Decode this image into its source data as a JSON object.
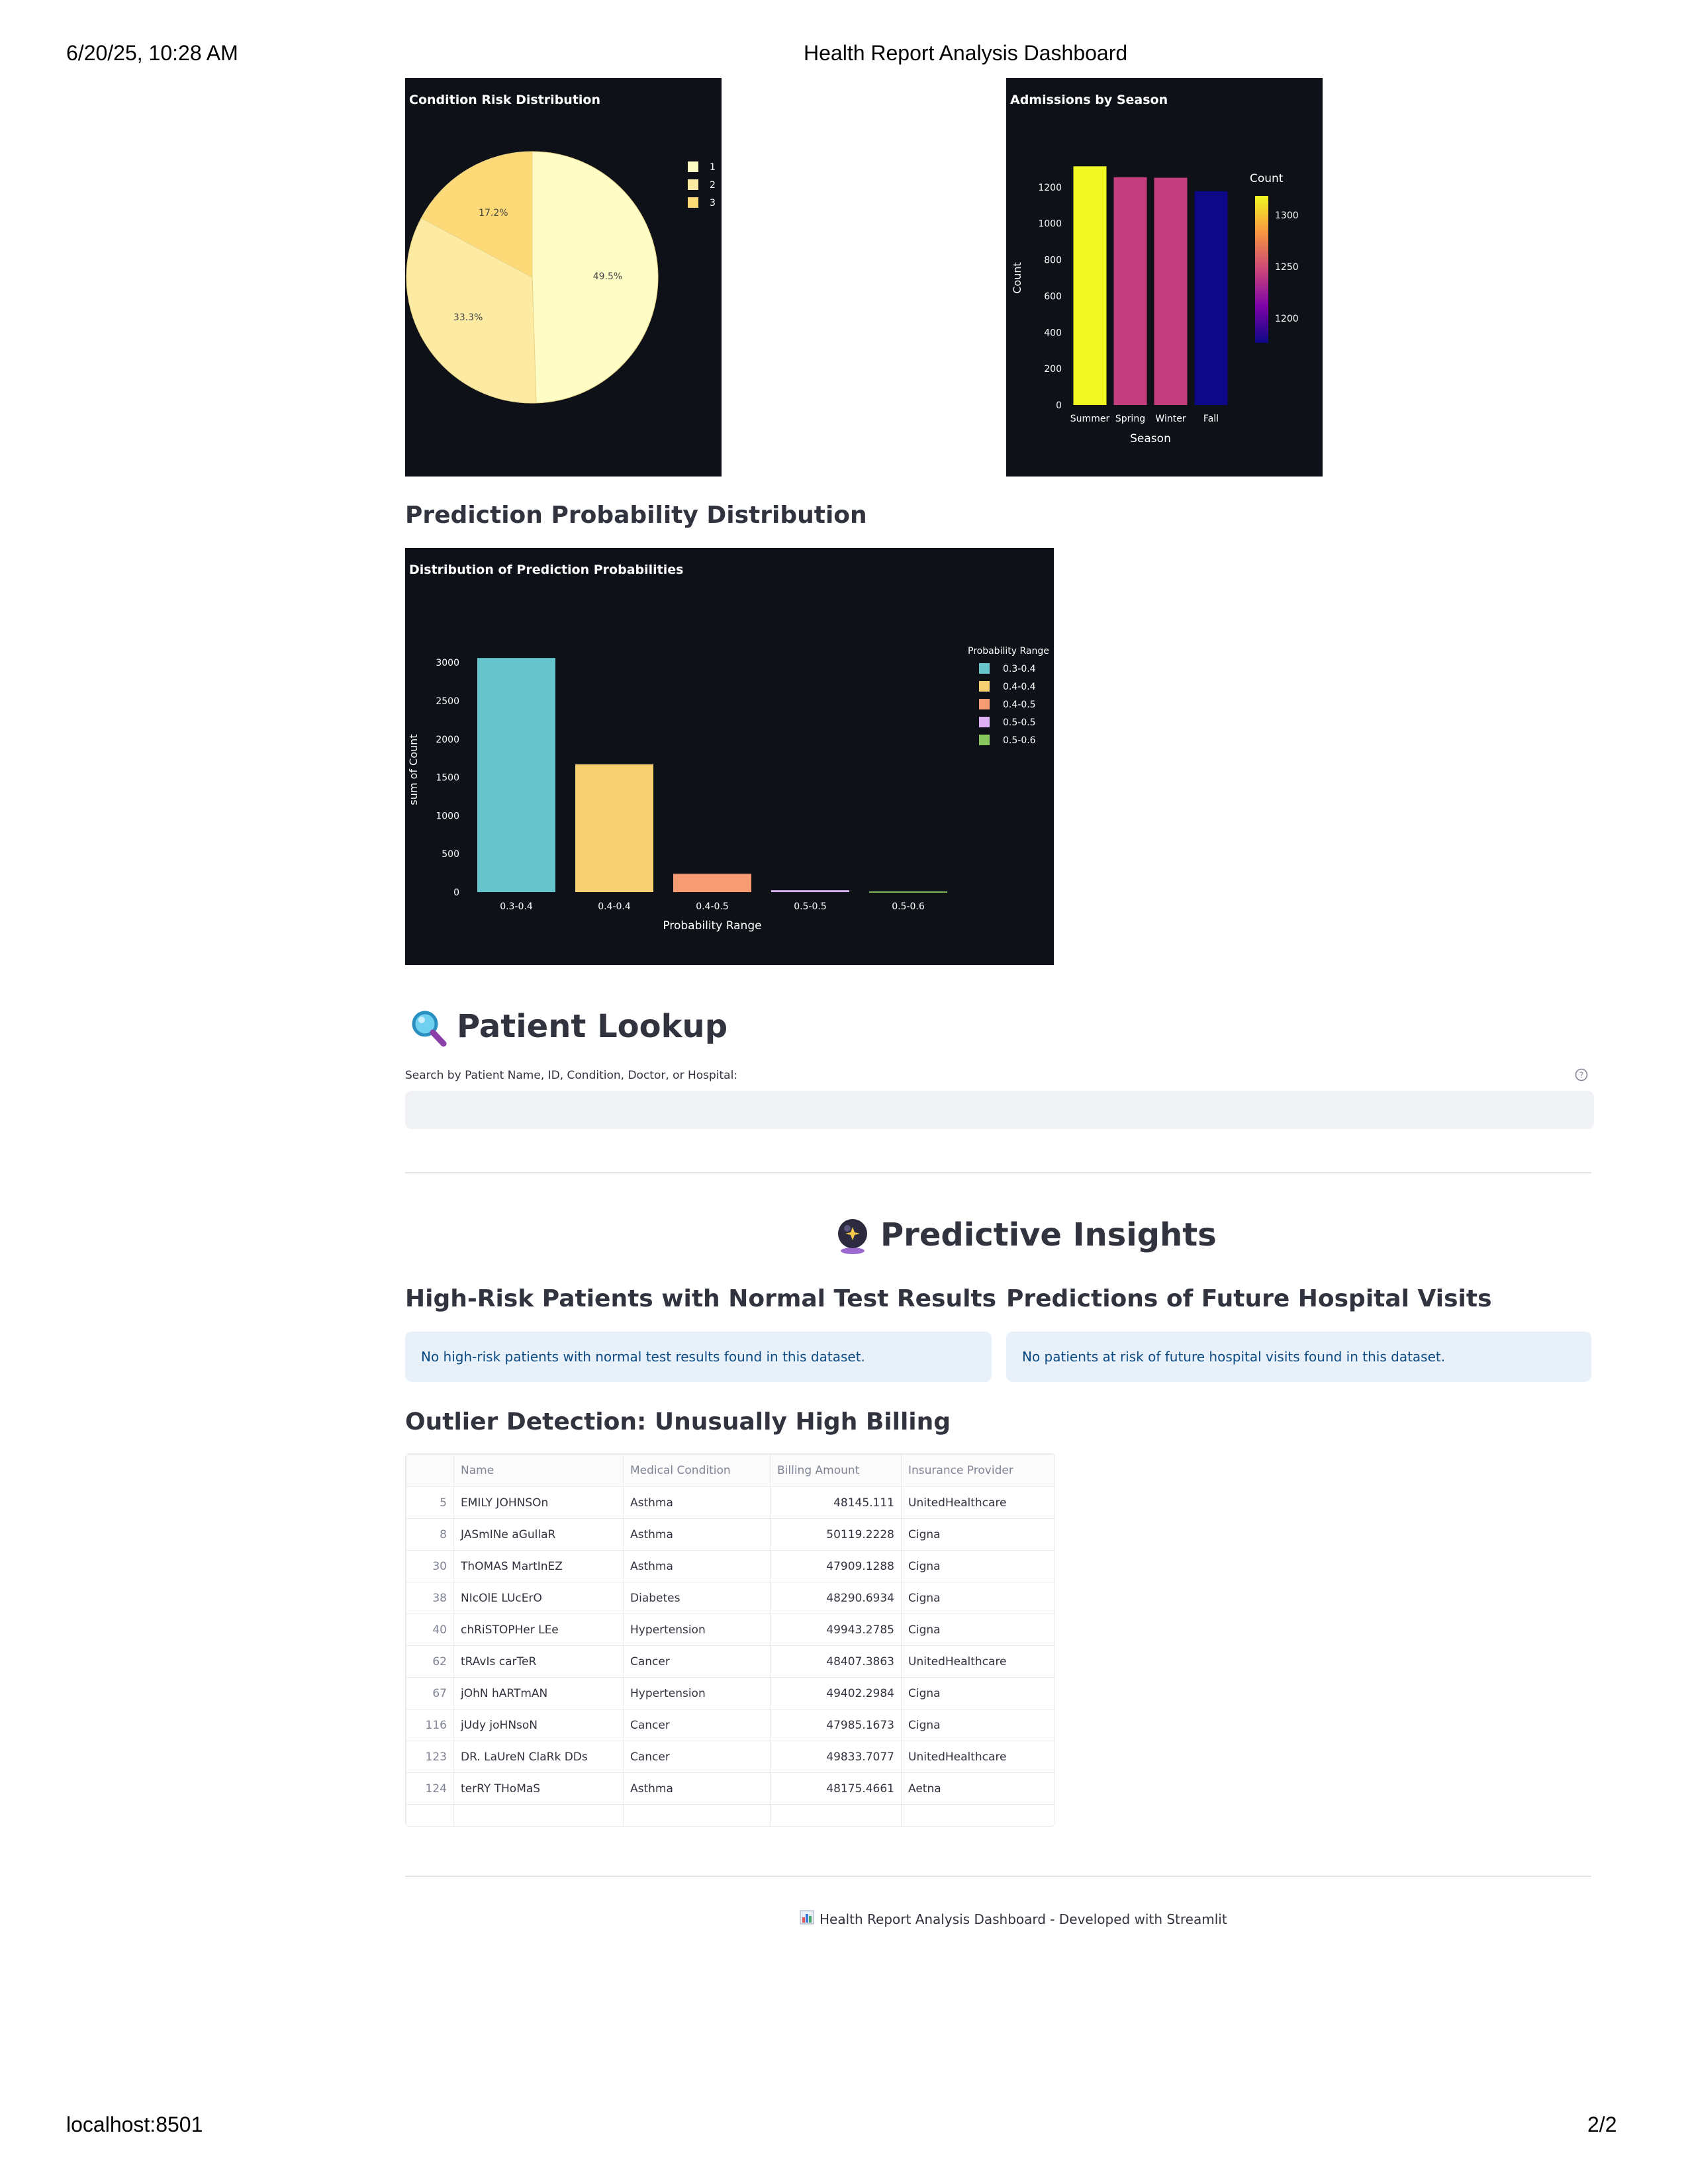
{
  "print_header": {
    "datetime": "6/20/25, 10:28 AM",
    "title": "Health Report Analysis Dashboard"
  },
  "print_footer": {
    "url": "localhost:8501",
    "page": "2/2"
  },
  "charts": {
    "risk_title": "Condition Risk Distribution",
    "season_title": "Admissions by Season",
    "prob_section_title": "Prediction Probability Distribution",
    "prob_title": "Distribution of Prediction Probabilities"
  },
  "chart_data": [
    {
      "type": "pie",
      "title": "Condition Risk Distribution",
      "labels": [
        "1",
        "2",
        "3"
      ],
      "values": [
        49.5,
        33.3,
        17.2
      ],
      "value_labels": [
        "49.5%",
        "33.3%",
        "17.2%"
      ],
      "colors": [
        "#fefdc6",
        "#feeba3",
        "#fed977"
      ],
      "legend": "top-right"
    },
    {
      "type": "bar",
      "title": "Admissions by Season",
      "categories": [
        "Summer",
        "Spring",
        "Winter",
        "Fall"
      ],
      "values": [
        1315,
        1255,
        1252,
        1178
      ],
      "xlabel": "Season",
      "ylabel": "Count",
      "ylim": [
        0,
        1400
      ],
      "yticks": [
        0,
        200,
        400,
        600,
        800,
        1000,
        1200
      ],
      "colors": [
        "#f0f921",
        "#c43e7e",
        "#c43e7e",
        "#0d0887"
      ],
      "colorbar": {
        "title": "Count",
        "ticks": [
          "1300",
          "1250",
          "1200"
        ],
        "placement": "right"
      }
    },
    {
      "type": "bar",
      "title": "Distribution of Prediction Probabilities",
      "categories": [
        "0.3-0.4",
        "0.4-0.4",
        "0.4-0.5",
        "0.5-0.5",
        "0.5-0.6"
      ],
      "values": [
        3060,
        1670,
        240,
        25,
        10
      ],
      "xlabel": "Probability Range",
      "ylabel": "sum of Count",
      "ylim": [
        0,
        3200
      ],
      "yticks": [
        0,
        500,
        1000,
        1500,
        2000,
        2500,
        3000
      ],
      "colors": [
        "#66c5cc",
        "#f6cf71",
        "#f89c74",
        "#dcb0f2",
        "#87c55f"
      ],
      "legend_title": "Probability Range",
      "legend": "top-right"
    }
  ],
  "patient_lookup": {
    "icon": "magnifier-icon",
    "title": "Patient Lookup",
    "search_label": "Search by Patient Name, ID, Condition, Doctor, or Hospital:",
    "search_value": ""
  },
  "insights": {
    "icon": "crystal-ball-icon",
    "title": "Predictive Insights",
    "high_risk_title_pre": "High-Risk Patients with ",
    "high_risk_title_bold": "Normal Test Results",
    "high_risk_info": "No high-risk patients with normal test results found in this dataset.",
    "future_title": "Predictions of Future Hospital Visits",
    "future_info": "No patients at risk of future hospital visits found in this dataset."
  },
  "outliers": {
    "title_pre": "Outlier Detection: Unu",
    "title_bold": "sually High Billing",
    "columns": [
      "",
      "Name",
      "Medical Condition",
      "Billing Amount",
      "Insurance Provider"
    ],
    "rows": [
      [
        "5",
        "EMILY JOHNSOn",
        "Asthma",
        "48145.111",
        "UnitedHealthcare"
      ],
      [
        "8",
        "JASmINe aGullaR",
        "Asthma",
        "50119.2228",
        "Cigna"
      ],
      [
        "30",
        "ThOMAS MartInEZ",
        "Asthma",
        "47909.1288",
        "Cigna"
      ],
      [
        "38",
        "NIcOlE LUcErO",
        "Diabetes",
        "48290.6934",
        "Cigna"
      ],
      [
        "40",
        "chRiSTOPHer LEe",
        "Hypertension",
        "49943.2785",
        "Cigna"
      ],
      [
        "62",
        "tRAvIs carTeR",
        "Cancer",
        "48407.3863",
        "UnitedHealthcare"
      ],
      [
        "67",
        "jOhN hARTmAN",
        "Hypertension",
        "49402.2984",
        "Cigna"
      ],
      [
        "116",
        "jUdy joHNsoN",
        "Cancer",
        "47985.1673",
        "Cigna"
      ],
      [
        "123",
        "DR. LaUreN ClaRk DDs",
        "Cancer",
        "49833.7077",
        "UnitedHealthcare"
      ],
      [
        "124",
        "terRY THoMaS",
        "Asthma",
        "48175.4661",
        "Aetna"
      ]
    ]
  },
  "footer": {
    "icon": "bar-chart-icon",
    "text": "Health Report Analysis Dashboard - Developed with Streamlit"
  }
}
